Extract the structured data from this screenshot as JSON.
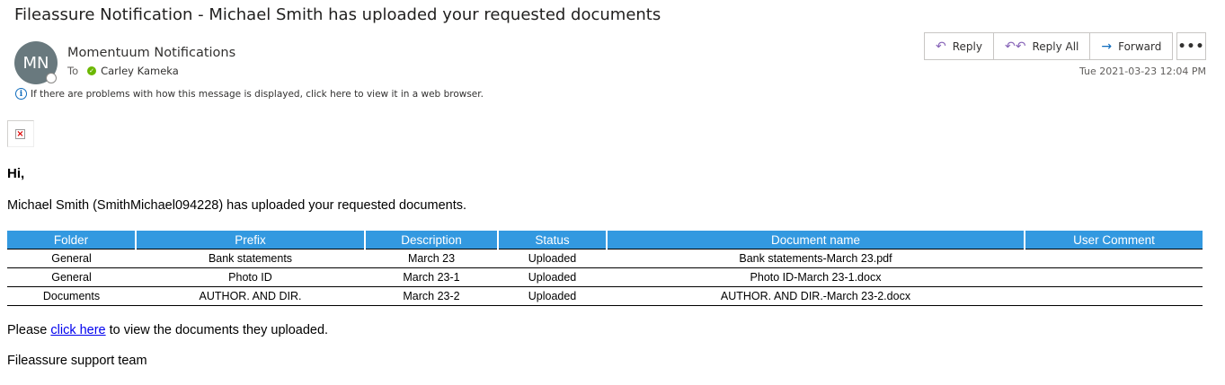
{
  "email": {
    "subject": "Fileassure Notification - Michael Smith has uploaded your requested documents",
    "avatar_initials": "MN",
    "sender": "Momentuum Notifications",
    "to_label": "To",
    "recipient": "Carley Kameka",
    "info_text": "If there are problems with how this message is displayed, click here to view it in a web browser.",
    "date": "Tue 2021-03-23 12:04 PM",
    "actions": {
      "reply": "Reply",
      "reply_all": "Reply All",
      "forward": "Forward",
      "more": "•••"
    },
    "colors": {
      "avatar": "#69797e",
      "table_header": "#3399e0",
      "link": "#0000ee"
    }
  },
  "body": {
    "greeting": "Hi,",
    "intro": "Michael Smith (SmithMichael094228) has uploaded your requested documents.",
    "table": {
      "headers": [
        "Folder",
        "Prefix",
        "Description",
        "Status",
        "Document name",
        "User Comment"
      ],
      "rows": [
        [
          "General",
          "Bank statements",
          "March 23",
          "Uploaded",
          "Bank statements-March 23.pdf",
          ""
        ],
        [
          "General",
          "Photo ID",
          "March 23-1",
          "Uploaded",
          "Photo ID-March 23-1.docx",
          ""
        ],
        [
          "Documents",
          "AUTHOR. AND DIR.",
          "March 23-2",
          "Uploaded",
          "AUTHOR. AND DIR.-March 23-2.docx",
          ""
        ]
      ]
    },
    "please_prefix": "Please ",
    "link_text": "click here",
    "please_suffix": " to view the documents they uploaded.",
    "signature": "Fileassure support team"
  }
}
